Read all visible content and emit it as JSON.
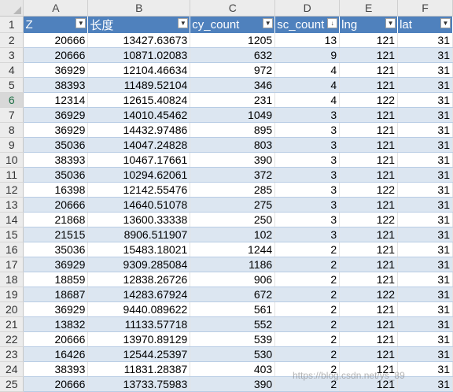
{
  "columns": [
    "A",
    "B",
    "C",
    "D",
    "E",
    "F"
  ],
  "headers": [
    "Z",
    "长度",
    "cy_count",
    "sc_count",
    "lng",
    "lat"
  ],
  "rows": [
    {
      "num": "2",
      "cells": [
        "20666",
        "13427.63673",
        "1205",
        "13",
        "121",
        "31"
      ]
    },
    {
      "num": "3",
      "cells": [
        "20666",
        "10871.02083",
        "632",
        "9",
        "121",
        "31"
      ]
    },
    {
      "num": "4",
      "cells": [
        "36929",
        "12104.46634",
        "972",
        "4",
        "121",
        "31"
      ]
    },
    {
      "num": "5",
      "cells": [
        "38393",
        "11489.52104",
        "346",
        "4",
        "121",
        "31"
      ]
    },
    {
      "num": "6",
      "cells": [
        "12314",
        "12615.40824",
        "231",
        "4",
        "122",
        "31"
      ]
    },
    {
      "num": "7",
      "cells": [
        "36929",
        "14010.45462",
        "1049",
        "3",
        "121",
        "31"
      ]
    },
    {
      "num": "8",
      "cells": [
        "36929",
        "14432.97486",
        "895",
        "3",
        "121",
        "31"
      ]
    },
    {
      "num": "9",
      "cells": [
        "35036",
        "14047.24828",
        "803",
        "3",
        "121",
        "31"
      ]
    },
    {
      "num": "10",
      "cells": [
        "38393",
        "10467.17661",
        "390",
        "3",
        "121",
        "31"
      ]
    },
    {
      "num": "11",
      "cells": [
        "35036",
        "10294.62061",
        "372",
        "3",
        "121",
        "31"
      ]
    },
    {
      "num": "12",
      "cells": [
        "16398",
        "12142.55476",
        "285",
        "3",
        "122",
        "31"
      ]
    },
    {
      "num": "13",
      "cells": [
        "20666",
        "14640.51078",
        "275",
        "3",
        "121",
        "31"
      ]
    },
    {
      "num": "14",
      "cells": [
        "21868",
        "13600.33338",
        "250",
        "3",
        "122",
        "31"
      ]
    },
    {
      "num": "15",
      "cells": [
        "21515",
        "8906.511907",
        "102",
        "3",
        "121",
        "31"
      ]
    },
    {
      "num": "16",
      "cells": [
        "35036",
        "15483.18021",
        "1244",
        "2",
        "121",
        "31"
      ]
    },
    {
      "num": "17",
      "cells": [
        "36929",
        "9309.285084",
        "1186",
        "2",
        "121",
        "31"
      ]
    },
    {
      "num": "18",
      "cells": [
        "18859",
        "12838.26726",
        "906",
        "2",
        "121",
        "31"
      ]
    },
    {
      "num": "19",
      "cells": [
        "18687",
        "14283.67924",
        "672",
        "2",
        "122",
        "31"
      ]
    },
    {
      "num": "20",
      "cells": [
        "36929",
        "9440.089622",
        "561",
        "2",
        "121",
        "31"
      ]
    },
    {
      "num": "21",
      "cells": [
        "13832",
        "11133.57718",
        "552",
        "2",
        "121",
        "31"
      ]
    },
    {
      "num": "22",
      "cells": [
        "20666",
        "13970.89129",
        "539",
        "2",
        "121",
        "31"
      ]
    },
    {
      "num": "23",
      "cells": [
        "16426",
        "12544.25397",
        "530",
        "2",
        "121",
        "31"
      ]
    },
    {
      "num": "24",
      "cells": [
        "38393",
        "11831.28387",
        "403",
        "2",
        "121",
        "31"
      ]
    },
    {
      "num": "25",
      "cells": [
        "20666",
        "13733.75983",
        "390",
        "2",
        "121",
        "31"
      ]
    }
  ],
  "header_row_num": "1",
  "selected_row": "6",
  "filter_icons": [
    "filter-dropdown-icon",
    "filter-dropdown-icon",
    "filter-dropdown-icon",
    "sort-descending-filter-icon",
    "filter-dropdown-icon",
    "filter-dropdown-icon"
  ],
  "filter_glyphs": [
    "▼",
    "▼",
    "▼",
    "↓",
    "▼",
    "▼"
  ],
  "watermark": "https://blog.csdn.net/ys_89",
  "colors": {
    "header_fill": "#4f81bd",
    "band_fill": "#dce6f1",
    "header_text": "#ffffff"
  }
}
